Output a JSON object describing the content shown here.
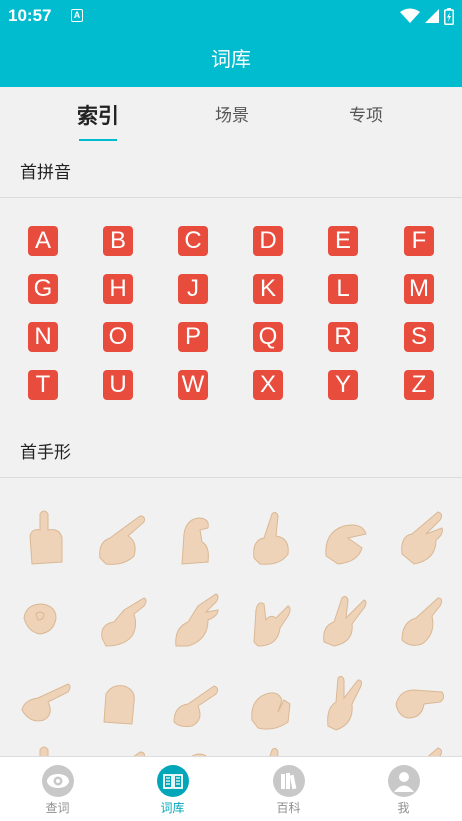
{
  "status": {
    "time": "10:57",
    "notif_letter": "A"
  },
  "header": {
    "title": "词库"
  },
  "tabs": [
    {
      "label": "索引",
      "active": true
    },
    {
      "label": "场景",
      "active": false
    },
    {
      "label": "专项",
      "active": false
    }
  ],
  "sections": {
    "pinyin_title": "首拼音",
    "handshape_title": "首手形"
  },
  "letters": [
    "A",
    "B",
    "C",
    "D",
    "E",
    "F",
    "G",
    "H",
    "J",
    "K",
    "L",
    "M",
    "N",
    "O",
    "P",
    "Q",
    "R",
    "S",
    "T",
    "U",
    "W",
    "X",
    "Y",
    "Z"
  ],
  "bottom_nav": [
    {
      "label": "查词",
      "icon": "eye-icon",
      "active": false
    },
    {
      "label": "词库",
      "icon": "book-icon",
      "active": true
    },
    {
      "label": "百科",
      "icon": "books-icon",
      "active": false
    },
    {
      "label": "我",
      "icon": "person-icon",
      "active": false
    }
  ],
  "colors": {
    "primary": "#01bccf",
    "letter_bg": "#e84c3d",
    "skin": "#efd3b8"
  }
}
